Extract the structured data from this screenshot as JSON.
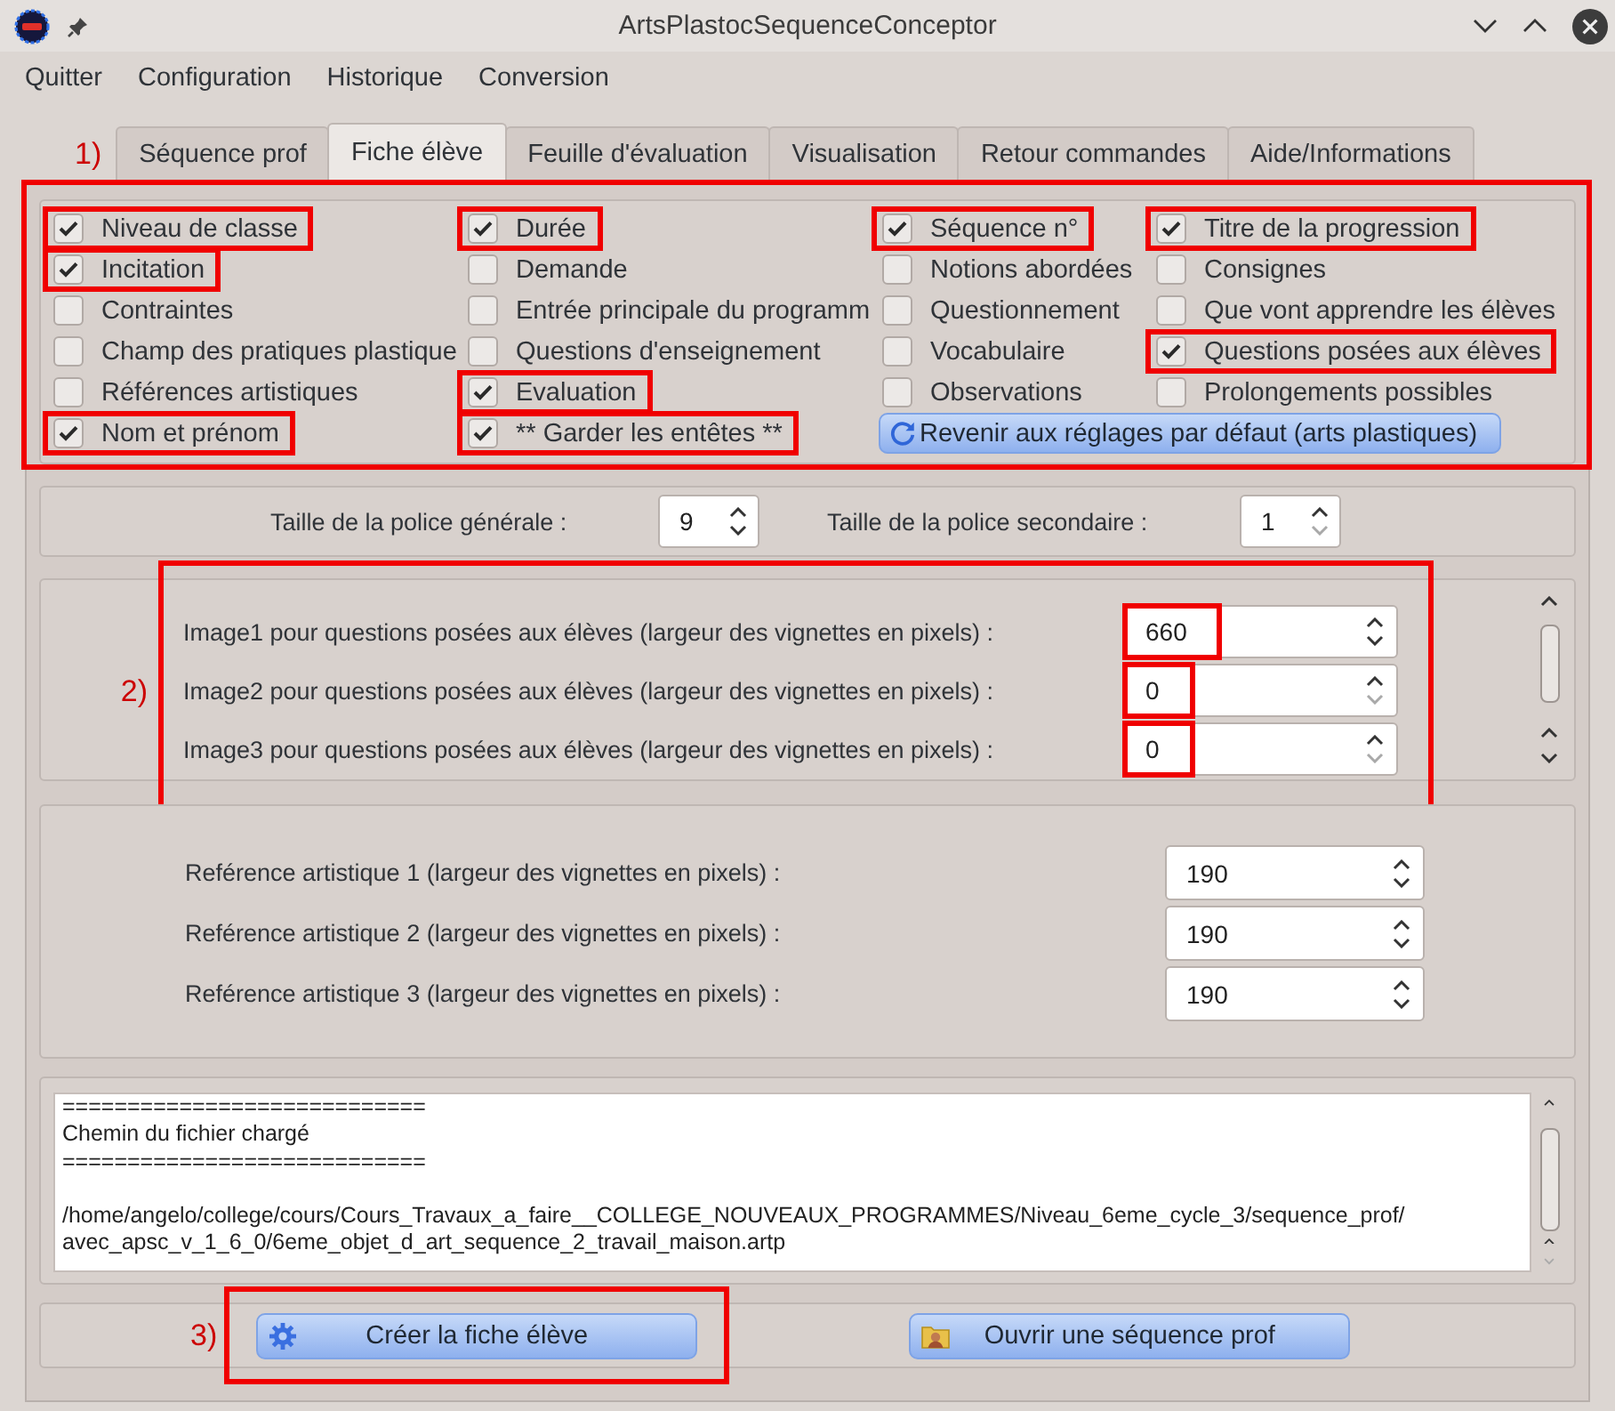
{
  "window": {
    "title": "ArtsPlastocSequenceConceptor"
  },
  "menu": [
    {
      "label": "Quitter"
    },
    {
      "label": "Configuration"
    },
    {
      "label": "Historique"
    },
    {
      "label": "Conversion"
    }
  ],
  "tabs": {
    "callout": "1)",
    "items": [
      {
        "label": "Séquence prof",
        "selected": false
      },
      {
        "label": "Fiche élève",
        "selected": true
      },
      {
        "label": "Feuille d'évaluation",
        "selected": false
      },
      {
        "label": "Visualisation",
        "selected": false
      },
      {
        "label": "Retour commandes",
        "selected": false
      },
      {
        "label": "Aide/Informations",
        "selected": false
      }
    ]
  },
  "options": {
    "highlighted": true,
    "columns": [
      {
        "items": [
          {
            "label": "Niveau de classe",
            "checked": true,
            "highlighted": true
          },
          {
            "label": "Incitation",
            "checked": true,
            "highlighted": true
          },
          {
            "label": "Contraintes",
            "checked": false,
            "highlighted": false
          },
          {
            "label": "Champ des pratiques plastique",
            "checked": false,
            "highlighted": false
          },
          {
            "label": "Références artistiques",
            "checked": false,
            "highlighted": false
          },
          {
            "label": "Nom et prénom",
            "checked": true,
            "highlighted": true
          }
        ]
      },
      {
        "items": [
          {
            "label": "Durée",
            "checked": true,
            "highlighted": true
          },
          {
            "label": "Demande",
            "checked": false,
            "highlighted": false
          },
          {
            "label": "Entrée principale du programm",
            "checked": false,
            "highlighted": false
          },
          {
            "label": "Questions d'enseignement",
            "checked": false,
            "highlighted": false
          },
          {
            "label": "Evaluation",
            "checked": true,
            "highlighted": true
          },
          {
            "label": "** Garder les entêtes **",
            "checked": true,
            "highlighted": true
          }
        ]
      },
      {
        "items": [
          {
            "label": "Séquence n°",
            "checked": true,
            "highlighted": true
          },
          {
            "label": "Notions abordées",
            "checked": false,
            "highlighted": false
          },
          {
            "label": "Questionnement",
            "checked": false,
            "highlighted": false
          },
          {
            "label": "Vocabulaire",
            "checked": false,
            "highlighted": false
          },
          {
            "label": "Observations",
            "checked": false,
            "highlighted": false
          }
        ],
        "button": {
          "label": "Revenir aux réglages par défaut (arts plastiques)"
        }
      },
      {
        "items": [
          {
            "label": "Titre de la progression",
            "checked": true,
            "highlighted": true
          },
          {
            "label": "Consignes",
            "checked": false,
            "highlighted": false
          },
          {
            "label": "Que vont apprendre les élèves",
            "checked": false,
            "highlighted": false
          },
          {
            "label": "Questions posées aux élèves",
            "checked": true,
            "highlighted": true
          },
          {
            "label": "Prolongements possibles",
            "checked": false,
            "highlighted": false
          }
        ]
      }
    ]
  },
  "font_sizes": [
    {
      "label": "Taille de la police générale :",
      "value": "9",
      "down_disabled": false
    },
    {
      "label": "Taille de la police secondaire :",
      "value": "1",
      "down_disabled": true
    }
  ],
  "image_section": {
    "callout": "2)",
    "highlighted": true,
    "rows": [
      {
        "label": "Image1 pour questions posées aux élèves (largeur des vignettes en pixels) :",
        "value": "660",
        "highlighted": true,
        "down_disabled": false
      },
      {
        "label": "Image2 pour questions posées aux élèves (largeur des vignettes en pixels) :",
        "value": "0",
        "highlighted": true,
        "down_disabled": true
      },
      {
        "label": "Image3 pour questions posées aux élèves (largeur des vignettes en pixels) :",
        "value": "0",
        "highlighted": true,
        "down_disabled": true
      }
    ]
  },
  "reference_section": {
    "rows": [
      {
        "label": "Reférence artistique 1 (largeur des vignettes en pixels) :",
        "value": "190",
        "down_disabled": false
      },
      {
        "label": "Reférence artistique 2 (largeur des vignettes en pixels) :",
        "value": "190",
        "down_disabled": false
      },
      {
        "label": "Reférence artistique 3 (largeur des vignettes en pixels) :",
        "value": "190",
        "down_disabled": false
      }
    ]
  },
  "log": {
    "paragraphs": [
      [
        "============================",
        "Chemin du fichier chargé",
        "============================"
      ],
      [
        "/home/angelo/college/cours/Cours_Travaux_a_faire__COLLEGE_NOUVEAUX_PROGRAMMES/Niveau_6eme_cycle_3/sequence_prof/",
        "avec_apsc_v_1_6_0/6eme_objet_d_art_sequence_2_travail_maison.artp"
      ]
    ]
  },
  "actions": {
    "callout": "3)",
    "buttons": [
      {
        "label": "Créer la fiche élève",
        "kind": "create",
        "highlighted": true
      },
      {
        "label": "Ouvrir une séquence prof",
        "kind": "open",
        "highlighted": false
      }
    ]
  }
}
